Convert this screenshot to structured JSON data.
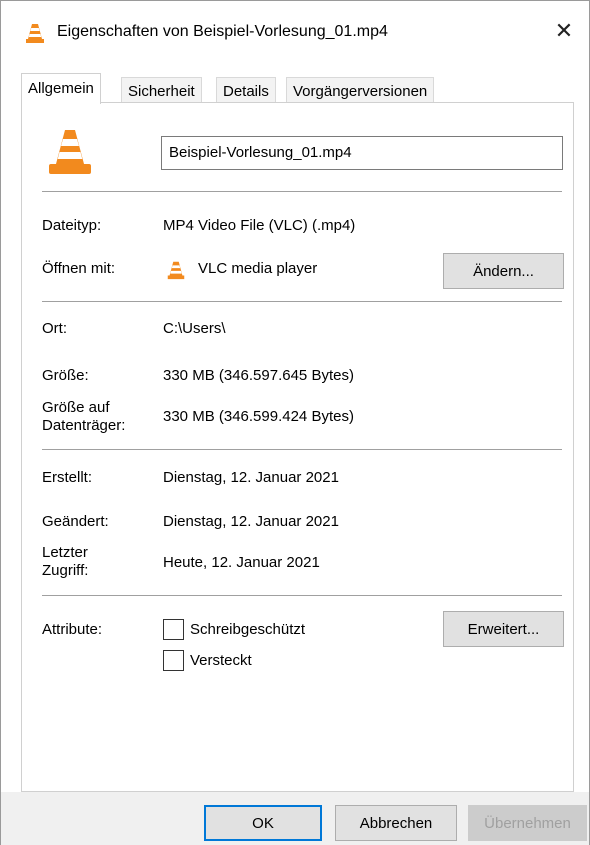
{
  "window": {
    "title": "Eigenschaften von Beispiel-Vorlesung_01.mp4",
    "close_glyph": "✕"
  },
  "tabs": [
    {
      "label": "Allgemein",
      "active": true
    },
    {
      "label": "Sicherheit",
      "active": false
    },
    {
      "label": "Details",
      "active": false
    },
    {
      "label": "Vorgängerversionen",
      "active": false
    }
  ],
  "general": {
    "file_name": "Beispiel-Vorlesung_01.mp4",
    "filetype_label": "Dateityp:",
    "filetype_value": "MP4 Video File (VLC) (.mp4)",
    "openwith_label": "Öffnen mit:",
    "openwith_value": "VLC media player",
    "change_button": "Ändern...",
    "location_label": "Ort:",
    "location_value": "C:\\Users\\",
    "size_label": "Größe:",
    "size_value": "330 MB (346.597.645 Bytes)",
    "disksize_label_1": "Größe auf",
    "disksize_label_2": "Datenträger:",
    "disksize_value": "330 MB (346.599.424 Bytes)",
    "created_label": "Erstellt:",
    "created_value": "Dienstag, 12. Januar 2021",
    "modified_label": "Geändert:",
    "modified_value": "Dienstag, 12. Januar 2021",
    "accessed_label_1": "Letzter",
    "accessed_label_2": "Zugriff:",
    "accessed_value": "Heute, 12. Januar 2021",
    "attributes_label": "Attribute:",
    "readonly_label": "Schreibgeschützt",
    "readonly_checked": false,
    "hidden_label": "Versteckt",
    "hidden_checked": false,
    "advanced_button": "Erweitert..."
  },
  "footer": {
    "ok": "OK",
    "cancel": "Abbrechen",
    "apply": "Übernehmen"
  },
  "icons": {
    "app_icon": "vlc-cone-icon",
    "accent_orange": "#f28a1e",
    "accent_white": "#ffffff"
  }
}
